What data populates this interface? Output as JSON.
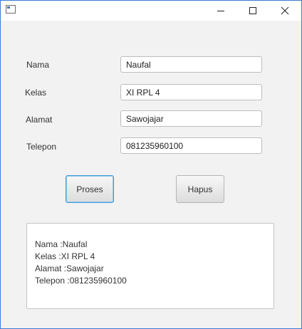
{
  "window": {
    "title": "",
    "icon": "app-window-icon",
    "controls": {
      "minimize_icon": "minimize-icon",
      "maximize_icon": "maximize-icon",
      "close_icon": "close-icon"
    },
    "border_color": "#3a7bd5"
  },
  "form": {
    "nama": {
      "label": "Nama",
      "value": "Naufal"
    },
    "kelas": {
      "label": "Kelas",
      "value": "XI RPL 4"
    },
    "alamat": {
      "label": "Alamat",
      "value": "Sawojajar"
    },
    "telepon": {
      "label": "Telepon",
      "value": "081235960100"
    }
  },
  "buttons": {
    "proses": "Proses",
    "hapus": "Hapus"
  },
  "output": {
    "lines": [
      "Nama :Naufal",
      "Kelas :XI RPL 4",
      "Alamat :Sawojajar",
      "Telepon :081235960100"
    ]
  }
}
